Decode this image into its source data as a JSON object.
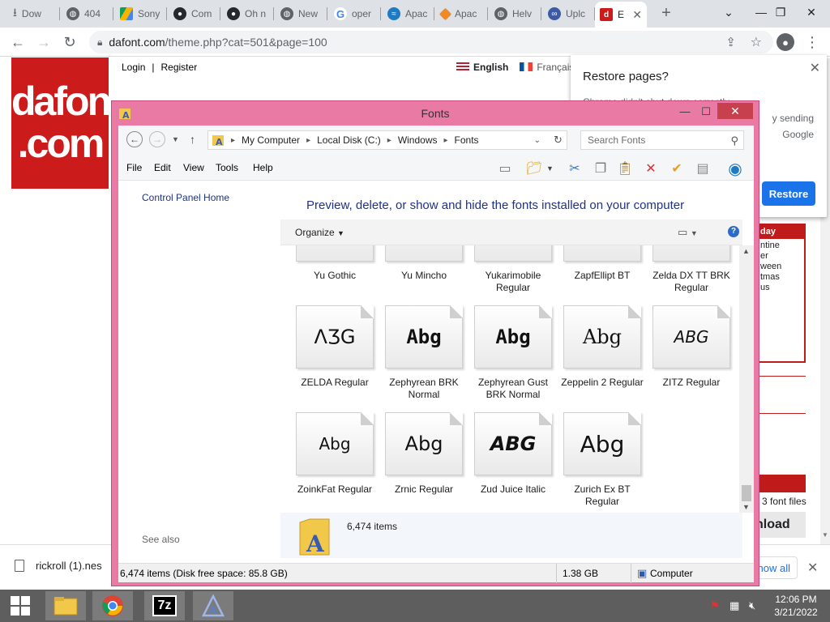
{
  "browser": {
    "tabs": [
      {
        "label": "Dow",
        "icon": "download-icon"
      },
      {
        "label": "404",
        "icon": "globe-icon"
      },
      {
        "label": "Sony",
        "icon": "drive-icon"
      },
      {
        "label": "Com",
        "icon": "github-icon"
      },
      {
        "label": "Oh n",
        "icon": "github-icon"
      },
      {
        "label": "New",
        "icon": "globe-icon"
      },
      {
        "label": "oper",
        "icon": "google-icon"
      },
      {
        "label": "Apac",
        "icon": "apache-icon"
      },
      {
        "label": "Apac",
        "icon": "apache-icon"
      },
      {
        "label": "Helv",
        "icon": "globe-icon"
      },
      {
        "label": "Uplc",
        "icon": "upload-icon"
      },
      {
        "label": "E",
        "icon": "dafont-icon"
      }
    ],
    "url_host": "dafont.com",
    "url_path": "/theme.php?cat=501&page=100"
  },
  "site": {
    "logo_line1": "dafont",
    "logo_line2": ".com",
    "login": "Login",
    "sep": "|",
    "register": "Register",
    "lang_en": "English",
    "lang_fr": "Français",
    "sidebox_header": "day",
    "sidebox_lines": [
      "ntine",
      "er",
      "ween",
      "tmas",
      "us"
    ],
    "font_files": "3 font files",
    "download": "nload"
  },
  "restore_popup": {
    "title": "Restore pages?",
    "body": "Chrome didn't shut down correctly.",
    "body2": "y sending",
    "body3": "Google",
    "button": "Restore"
  },
  "downloads": {
    "file": "rickroll (1).nes",
    "show_all": "how all"
  },
  "explorer": {
    "title": "Fonts",
    "breadcrumb": [
      "My Computer",
      "Local Disk (C:)",
      "Windows",
      "Fonts"
    ],
    "search_placeholder": "Search Fonts",
    "menu": [
      "File",
      "Edit",
      "View",
      "Tools",
      "Help"
    ],
    "control_panel_home": "Control Panel Home",
    "see_also": "See also",
    "heading": "Preview, delete, or show and hide the fonts installed on your computer",
    "organize": "Organize",
    "fonts": [
      {
        "name": "Yu Gothic",
        "sample": "",
        "partial": true
      },
      {
        "name": "Yu Mincho",
        "sample": "",
        "partial": true
      },
      {
        "name": "Yukarimobile Regular",
        "sample": "",
        "partial": true
      },
      {
        "name": "ZapfEllipt BT",
        "sample": "",
        "partial": true
      },
      {
        "name": "Zelda DX TT BRK Regular",
        "sample": "",
        "partial": true
      },
      {
        "name": "ZELDA Regular",
        "sample": "ΛƷG"
      },
      {
        "name": "Zephyrean BRK Normal",
        "sample": "Abg"
      },
      {
        "name": "Zephyrean Gust BRK Normal",
        "sample": "Abg"
      },
      {
        "name": "Zeppelin 2 Regular",
        "sample": "Abg"
      },
      {
        "name": "ZITZ Regular",
        "sample": "ABG"
      },
      {
        "name": "ZoinkFat Regular",
        "sample": "Abg"
      },
      {
        "name": "Zrnic Regular",
        "sample": "Abg"
      },
      {
        "name": "Zud Juice Italic",
        "sample": "ABG"
      },
      {
        "name": "Zurich Ex BT Regular",
        "sample": "Abg"
      }
    ],
    "details_count": "6,474 items",
    "status_left": "6,474 items (Disk free space: 85.8 GB)",
    "status_size": "1.38 GB",
    "status_location": "Computer"
  },
  "taskbar": {
    "time": "12:06 PM",
    "date": "3/21/2022"
  },
  "colors": {
    "dafont_red": "#cc1b1b",
    "explorer_frame": "#e87aa3",
    "chrome_blue": "#1a73e8",
    "taskbar": "#5e5e5e"
  }
}
